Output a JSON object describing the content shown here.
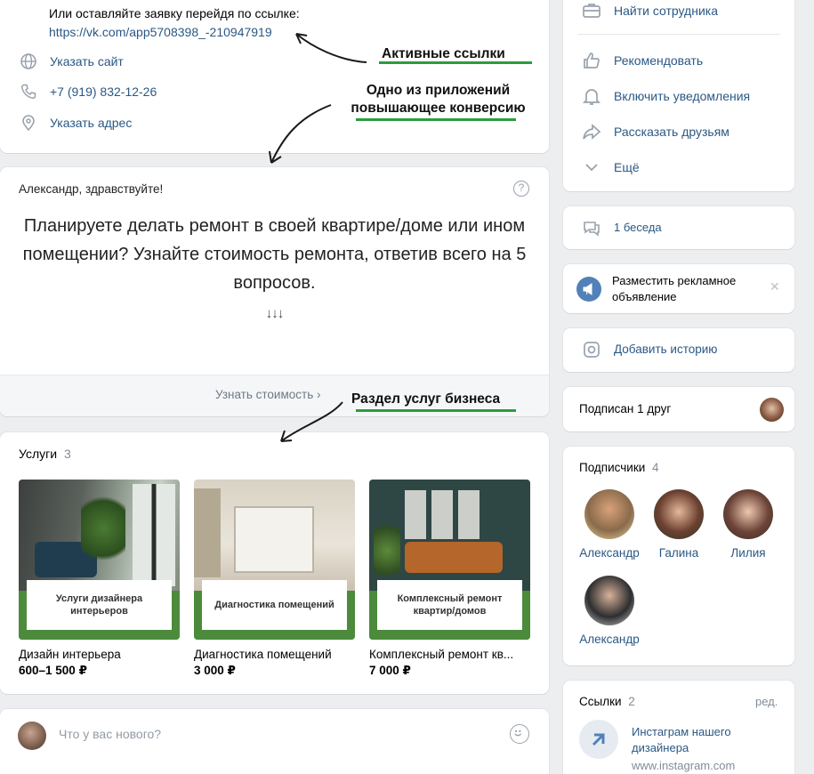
{
  "contacts": {
    "request_text": "Или оставляйте заявку перейдя по ссылке:",
    "request_link": "https://vk.com/app5708398_-210947919",
    "site": "Указать сайт",
    "phone": "+7 (919) 832-12-26",
    "address": "Указать адрес"
  },
  "annotations": {
    "active_links": "Активные ссылки",
    "app_note_line1": "Одно из приложений",
    "app_note_line2": "повышающее конверсию",
    "services_note": "Раздел услуг бизнеса"
  },
  "app_widget": {
    "greeting": "Александр, здравствуйте!",
    "help": "?",
    "message": "Планируете делать ремонт в своей квартире/доме или ином помещении? Узнайте стоимость ремонта, ответив всего на 5 вопросов.",
    "arrows": "↓↓↓",
    "cta": "Узнать стоимость ›"
  },
  "services": {
    "title": "Услуги",
    "count": "3",
    "items": [
      {
        "plate": "Услуги дизайнера интерьеров",
        "name": "Дизайн интерьера",
        "price": "600–1 500 ₽"
      },
      {
        "plate": "Диагностика помещений",
        "name": "Диагностика помещений",
        "price": "3 000 ₽"
      },
      {
        "plate": "Комплексный ремонт квартир/домов",
        "name": "Комплексный ремонт кв...",
        "price": "7 000 ₽"
      }
    ]
  },
  "post": {
    "placeholder": "Что у вас нового?"
  },
  "actions": {
    "find_employee": "Найти сотрудника",
    "recommend": "Рекомендовать",
    "notifications": "Включить уведомления",
    "tell_friends": "Рассказать друзьям",
    "more": "Ещё"
  },
  "conversation": "1 беседа",
  "ad": {
    "text": "Разместить рекламное объявление",
    "close": "✕"
  },
  "story": "Добавить историю",
  "subscribed": "Подписан 1 друг",
  "followers": {
    "title": "Подписчики",
    "count": "4",
    "people": [
      "Александр",
      "Галина",
      "Лилия",
      "Александр"
    ]
  },
  "links": {
    "title": "Ссылки",
    "count": "2",
    "edit": "ред.",
    "item_title": "Инстаграм нашего дизайнера",
    "item_url": "www.instagram.com"
  },
  "colors": {
    "link": "#2a5885",
    "annotation_underline": "#2a9d3f",
    "services_green": "#4b8b3b"
  }
}
